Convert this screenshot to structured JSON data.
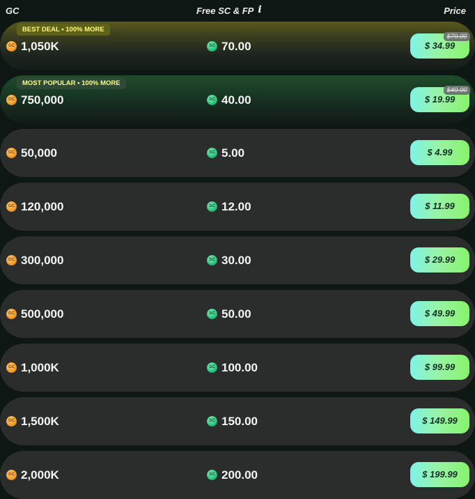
{
  "header": {
    "gc_label": "GC",
    "free_label": "Free SC & FP",
    "price_label": "Price"
  },
  "icons": {
    "gc": "gold-coin-icon",
    "sc": "green-coin-icon",
    "info": "info-icon"
  },
  "coin_text": {
    "gc": "GC",
    "sc": "SC"
  },
  "colors": {
    "gc_coin": "#f29a2a",
    "sc_coin": "#25c27a",
    "price_button": "#86f36a",
    "row_bg": "#2b2d2d"
  },
  "packages": [
    {
      "badge": "BEST DEAL • 100% MORE",
      "gc": "1,050K",
      "sc": "70.00",
      "price": "$ 34.99",
      "old_price": "$70.00"
    },
    {
      "badge": "MOST POPULAR • 100% MORE",
      "gc": "750,000",
      "sc": "40.00",
      "price": "$ 19.99",
      "old_price": "$40.00"
    },
    {
      "gc": "50,000",
      "sc": "5.00",
      "price": "$ 4.99"
    },
    {
      "gc": "120,000",
      "sc": "12.00",
      "price": "$ 11.99"
    },
    {
      "gc": "300,000",
      "sc": "30.00",
      "price": "$ 29.99"
    },
    {
      "gc": "500,000",
      "sc": "50.00",
      "price": "$ 49.99"
    },
    {
      "gc": "1,000K",
      "sc": "100.00",
      "price": "$ 99.99"
    },
    {
      "gc": "1,500K",
      "sc": "150.00",
      "price": "$ 149.99"
    },
    {
      "gc": "2,000K",
      "sc": "200.00",
      "price": "$ 199.99"
    }
  ]
}
